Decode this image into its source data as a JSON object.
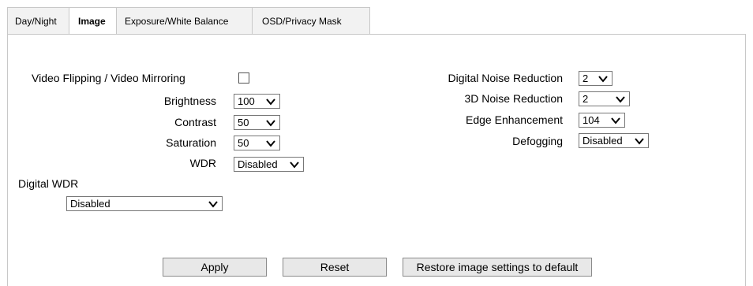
{
  "tabs": [
    {
      "label": "Day/Night"
    },
    {
      "label": "Image"
    },
    {
      "label": "Exposure/White Balance"
    },
    {
      "label": "OSD/Privacy Mask"
    }
  ],
  "left": {
    "flip_mirror_label": "Video Flipping / Video Mirroring",
    "flip_mirror_checked": false,
    "brightness": {
      "label": "Brightness",
      "value": "100"
    },
    "contrast": {
      "label": "Contrast",
      "value": "50"
    },
    "saturation": {
      "label": "Saturation",
      "value": "50"
    },
    "wdr": {
      "label": "WDR",
      "value": "Disabled"
    },
    "digital_wdr": {
      "label": "Digital WDR",
      "value": "Disabled"
    }
  },
  "right": {
    "dnr": {
      "label": "Digital Noise Reduction",
      "value": "2"
    },
    "nr3d": {
      "label": "3D Noise Reduction",
      "value": "2"
    },
    "edge": {
      "label": "Edge Enhancement",
      "value": "104"
    },
    "defog": {
      "label": "Defogging",
      "value": "Disabled"
    }
  },
  "buttons": {
    "apply": "Apply",
    "reset": "Reset",
    "restore": "Restore image settings to default"
  }
}
